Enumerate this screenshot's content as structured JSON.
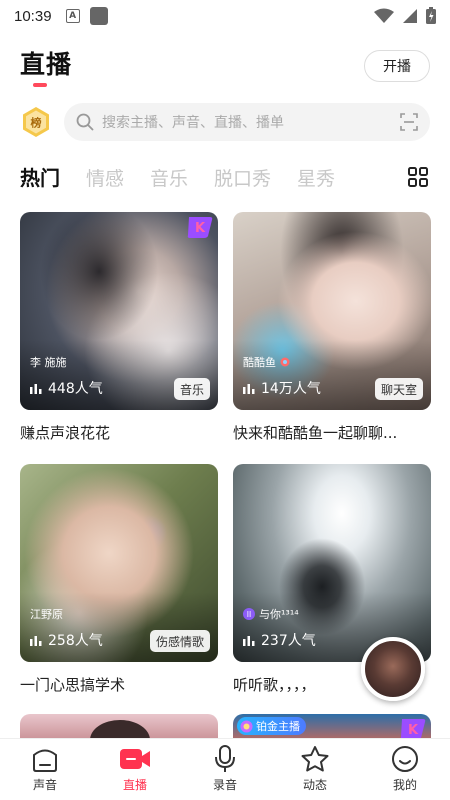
{
  "status_bar": {
    "time": "10:39",
    "a_icon": "A"
  },
  "header": {
    "title": "直播",
    "live_button": "开播"
  },
  "search": {
    "rank_badge": "榜",
    "placeholder": "搜索主播、声音、直播、播单"
  },
  "tabs": [
    {
      "label": "热门",
      "active": true
    },
    {
      "label": "情感",
      "active": false
    },
    {
      "label": "音乐",
      "active": false
    },
    {
      "label": "脱口秀",
      "active": false
    },
    {
      "label": "星秀",
      "active": false
    }
  ],
  "cards": [
    {
      "host": "李 施施",
      "popularity": "448人气",
      "tag": "音乐",
      "title": "赚点声浪花花",
      "pk_badge": "K"
    },
    {
      "host": "酷酷鱼",
      "popularity": "14万人气",
      "tag": "聊天室",
      "title": "快来和酷酷鱼一起聊聊..."
    },
    {
      "host": "江野原",
      "popularity": "258人气",
      "tag": "伤感情歌",
      "title": "一门心思搞学术"
    },
    {
      "host": "与你¹³¹⁴",
      "popularity": "237人气",
      "tag": "",
      "title": "听听歌，，，，",
      "pk_badge": ""
    }
  ],
  "peek": {
    "gold_label": "铂金主播",
    "pk_badge": "K"
  },
  "bottom_nav": [
    {
      "label": "声音",
      "icon": "house-icon",
      "active": false
    },
    {
      "label": "直播",
      "icon": "video-camera-icon",
      "active": true
    },
    {
      "label": "录音",
      "icon": "microphone-icon",
      "active": false
    },
    {
      "label": "动态",
      "icon": "star-icon",
      "active": false
    },
    {
      "label": "我的",
      "icon": "smiley-face-icon",
      "active": false
    }
  ],
  "colors": {
    "accent": "#ff3350",
    "tab_inactive": "#c8c8c8",
    "search_bg": "#f3f3f3"
  }
}
